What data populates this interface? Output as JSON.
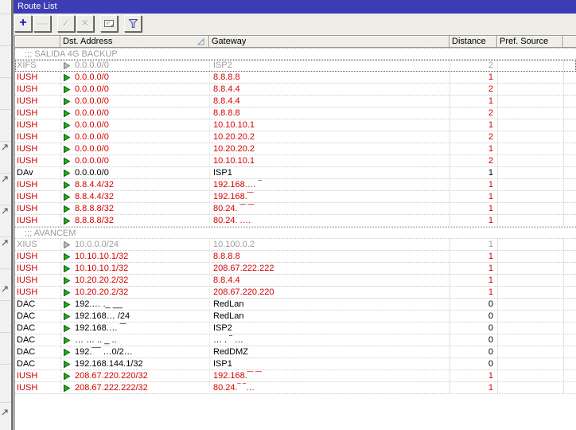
{
  "window": {
    "title": "Route List"
  },
  "toolbar": {
    "buttons": [
      {
        "id": "add",
        "icon": "plus-icon",
        "enabled": true
      },
      {
        "id": "remove",
        "icon": "minus-icon",
        "enabled": false
      },
      {
        "id": "enable",
        "icon": "check-icon",
        "enabled": false
      },
      {
        "id": "disable",
        "icon": "cross-icon",
        "enabled": false
      },
      {
        "id": "comment",
        "icon": "note-icon",
        "enabled": true
      },
      {
        "id": "filter",
        "icon": "funnel-icon",
        "enabled": true
      }
    ]
  },
  "table": {
    "columns": [
      "",
      "Dst. Address",
      "Gateway",
      "Distance",
      "Pref. Source",
      ""
    ],
    "sorted_column": "Dst. Address",
    "rows": [
      {
        "kind": "comment",
        "text": ";;; SALIDA 4G BACKUP"
      },
      {
        "kind": "route",
        "flags": "XIFS",
        "dst": "0.0.0.0/0",
        "gateway": "ISP2",
        "distance": "2",
        "pref": "",
        "state": "inactive",
        "focused": true
      },
      {
        "kind": "route",
        "flags": "IUSH",
        "dst": "0.0.0.0/0",
        "gateway": "8.8.8.8",
        "distance": "1",
        "pref": "",
        "state": "red"
      },
      {
        "kind": "route",
        "flags": "IUSH",
        "dst": "0.0.0.0/0",
        "gateway": "8.8.4.4",
        "distance": "2",
        "pref": "",
        "state": "red"
      },
      {
        "kind": "route",
        "flags": "IUSH",
        "dst": "0.0.0.0/0",
        "gateway": "8.8.4.4",
        "distance": "1",
        "pref": "",
        "state": "red"
      },
      {
        "kind": "route",
        "flags": "IUSH",
        "dst": "0.0.0.0/0",
        "gateway": "8.8.8.8",
        "distance": "2",
        "pref": "",
        "state": "red"
      },
      {
        "kind": "route",
        "flags": "IUSH",
        "dst": "0.0.0.0/0",
        "gateway": "10.10.10.1",
        "distance": "1",
        "pref": "",
        "state": "red"
      },
      {
        "kind": "route",
        "flags": "IUSH",
        "dst": "0.0.0.0/0",
        "gateway": "10.20.20.2",
        "distance": "2",
        "pref": "",
        "state": "red"
      },
      {
        "kind": "route",
        "flags": "IUSH",
        "dst": "0.0.0.0/0",
        "gateway": "10.20.20.2",
        "distance": "1",
        "pref": "",
        "state": "red"
      },
      {
        "kind": "route",
        "flags": "IUSH",
        "dst": "0.0.0.0/0",
        "gateway": "10.10.10.1",
        "distance": "2",
        "pref": "",
        "state": "red"
      },
      {
        "kind": "route",
        "flags": "DAv",
        "dst": "0.0.0.0/0",
        "gateway": "ISP1",
        "distance": "1",
        "pref": "",
        "state": "black"
      },
      {
        "kind": "route",
        "flags": "IUSH",
        "dst": "8.8.4.4/32",
        "gateway": "192.168.…  ‾",
        "distance": "1",
        "pref": "",
        "state": "red"
      },
      {
        "kind": "route",
        "flags": "IUSH",
        "dst": "8.8.4.4/32",
        "gateway": "192.168.‾‾",
        "distance": "1",
        "pref": "",
        "state": "red"
      },
      {
        "kind": "route",
        "flags": "IUSH",
        "dst": "8.8.8.8/32",
        "gateway": "80.24.  ‾‾ ‾‾",
        "distance": "1",
        "pref": "",
        "state": "red"
      },
      {
        "kind": "route",
        "flags": "IUSH",
        "dst": "8.8.8.8/32",
        "gateway": "80.24.  .…",
        "distance": "1",
        "pref": "",
        "state": "red"
      },
      {
        "kind": "comment",
        "text": ";;; AVANCEM"
      },
      {
        "kind": "route",
        "flags": "XIUS",
        "dst": "10.0.0.0/24",
        "gateway": "10.100.0.2",
        "distance": "1",
        "pref": "",
        "state": "inactive"
      },
      {
        "kind": "route",
        "flags": "IUSH",
        "dst": "10.10.10.1/32",
        "gateway": "8.8.8.8",
        "distance": "1",
        "pref": "",
        "state": "red"
      },
      {
        "kind": "route",
        "flags": "IUSH",
        "dst": "10.10.10.1/32",
        "gateway": "208.67.222.222",
        "distance": "1",
        "pref": "",
        "state": "red"
      },
      {
        "kind": "route",
        "flags": "IUSH",
        "dst": "10.20.20.2/32",
        "gateway": "8.8.4.4",
        "distance": "1",
        "pref": "",
        "state": "red"
      },
      {
        "kind": "route",
        "flags": "IUSH",
        "dst": "10.20.20.2/32",
        "gateway": "208.67.220.220",
        "distance": "1",
        "pref": "",
        "state": "red"
      },
      {
        "kind": "route",
        "flags": "DAC",
        "dst": "192.…   ._ __",
        "gateway": "RedLan",
        "distance": "0",
        "pref": "",
        "state": "black"
      },
      {
        "kind": "route",
        "flags": "DAC",
        "dst": "192.168…  /24",
        "gateway": "RedLan",
        "distance": "0",
        "pref": "",
        "state": "black"
      },
      {
        "kind": "route",
        "flags": "DAC",
        "dst": "192.168.…  ‾‾",
        "gateway": "ISP2",
        "distance": "0",
        "pref": "",
        "state": "black"
      },
      {
        "kind": "route",
        "flags": "DAC",
        "dst": "… … .. _ ..",
        "gateway": "… .  ‾ …",
        "distance": "0",
        "pref": "",
        "state": "black"
      },
      {
        "kind": "route",
        "flags": "DAC",
        "dst": "192.‾‾‾  …0/2…",
        "gateway": "RedDMZ",
        "distance": "0",
        "pref": "",
        "state": "black"
      },
      {
        "kind": "route",
        "flags": "DAC",
        "dst": "192.168.144.1/32",
        "gateway": "ISP1",
        "distance": "0",
        "pref": "",
        "state": "black"
      },
      {
        "kind": "route",
        "flags": "IUSH",
        "dst": "208.67.220.220/32",
        "gateway": "192.168.‾‾ ‾‾",
        "distance": "1",
        "pref": "",
        "state": "red"
      },
      {
        "kind": "route",
        "flags": "IUSH",
        "dst": "208.67.222.222/32",
        "gateway": "80.24.‾  ‾…",
        "distance": "1",
        "pref": "",
        "state": "red"
      }
    ]
  },
  "colors": {
    "titlebar": "#3c3cb4",
    "active_route_text": "#d40000",
    "inactive_route_text": "#9c9c9c",
    "static_route_text": "#000000",
    "arrow_green": "#19b219"
  }
}
